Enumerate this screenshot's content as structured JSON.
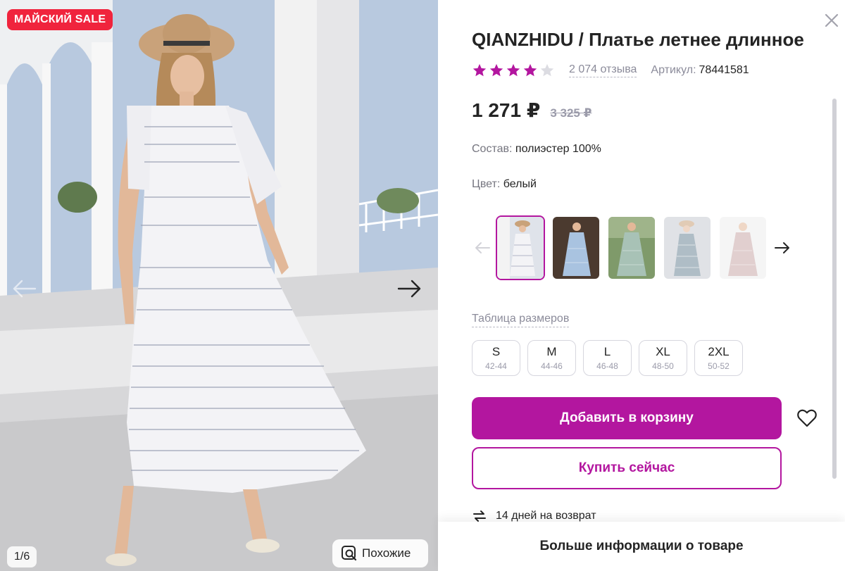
{
  "gallery": {
    "sale_badge": "МАЙСКИЙ SALE",
    "counter": "1/6",
    "similar_label": "Похожие"
  },
  "product": {
    "title": "QIANZHIDU / Платье летнее длинное",
    "rating": 4,
    "rating_max": 5,
    "reviews": "2 074 отзыва",
    "article_label": "Артикул:",
    "article_value": "78441581",
    "price": "1 271 ₽",
    "old_price": "3 325 ₽",
    "composition_label": "Состав:",
    "composition_value": "полиэстер 100%",
    "color_label": "Цвет:",
    "color_value": "белый",
    "size_table_link": "Таблица размеров",
    "sizes": [
      {
        "size": "S",
        "range": "42-44"
      },
      {
        "size": "M",
        "range": "44-46"
      },
      {
        "size": "L",
        "range": "46-48"
      },
      {
        "size": "XL",
        "range": "48-50"
      },
      {
        "size": "2XL",
        "range": "50-52"
      }
    ]
  },
  "actions": {
    "add_to_cart": "Добавить в корзину",
    "buy_now": "Купить сейчас",
    "returns": "14 дней на возврат",
    "more_info": "Больше информации о товаре"
  },
  "colors": {
    "accent": "#b3169f",
    "sale": "#f0243d",
    "star": "#b3169f",
    "star_empty": "#dcdce2"
  },
  "icons": [
    "close-icon",
    "star-icon",
    "arrow-left-icon",
    "arrow-right-icon",
    "heart-icon",
    "return-icon",
    "similar-search-icon"
  ]
}
